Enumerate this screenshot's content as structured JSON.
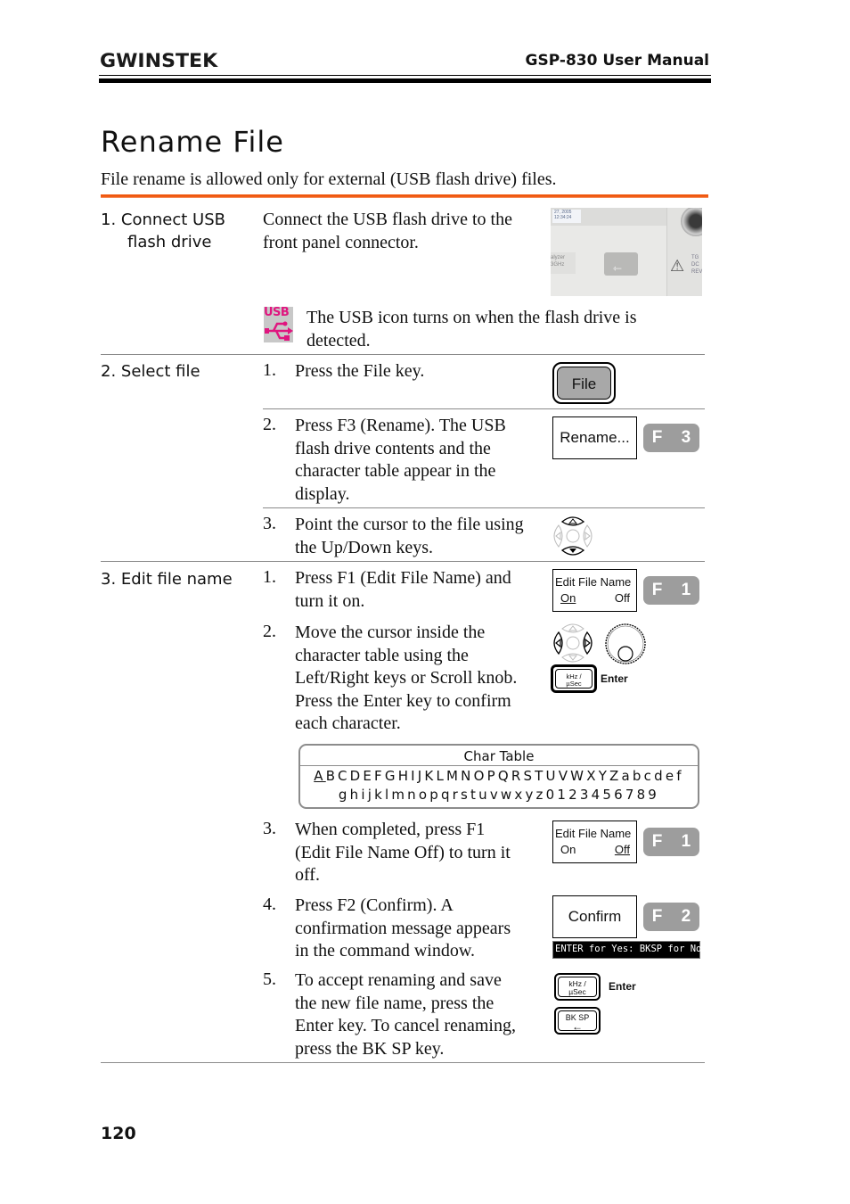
{
  "header": {
    "logo": "GWINSTEK",
    "manual_title": "GSP-830 User Manual"
  },
  "section": {
    "title": "Rename File",
    "intro": "File rename is allowed only for external (USB flash drive) files."
  },
  "steps": [
    {
      "label": "1.  Connect USB flash drive",
      "label_line1": "1.  Connect USB",
      "label_line2": "flash drive",
      "text": "Connect the USB flash drive to the front panel connector.",
      "text_line1": "Connect the USB flash drive to the",
      "text_line2": "front panel connector.",
      "image": {
        "name": "front-panel-usb-port-photo",
        "overlay_text": [
          "27, 2005",
          "12:34:24",
          "alyzer",
          "3GHz",
          "TG",
          "DC",
          "REV"
        ]
      },
      "note_icon": "usb-icon",
      "note_icon_text": "USB",
      "note": "The USB icon turns on when the flash drive is detected.",
      "note_line1": "The USB icon turns on when the flash drive is",
      "note_line2": "detected."
    },
    {
      "label": "2. Select file",
      "substeps": [
        {
          "num": "1.",
          "lines": [
            "Press the File key."
          ],
          "key": "File"
        },
        {
          "num": "2.",
          "lines": [
            "Press F3 (Rename). The USB",
            "flash drive contents and the",
            "character table appear in the",
            "display."
          ],
          "softkey": "Rename...",
          "fkey": "F 3"
        },
        {
          "num": "3.",
          "lines": [
            "Point the cursor to the file using",
            "the Up/Down keys."
          ],
          "icon": "arrow-keys-icon"
        }
      ]
    },
    {
      "label": "3. Edit file name",
      "substeps": [
        {
          "num": "1.",
          "lines": [
            "Press F1 (Edit File Name) and",
            "turn it on."
          ],
          "softkey_title": "Edit File Name",
          "softkey_on": "On",
          "softkey_off": "Off",
          "selected": "On",
          "fkey": "F 1"
        },
        {
          "num": "2.",
          "lines": [
            "Move the cursor inside the",
            "character table using the",
            "Left/Right keys or Scroll knob.",
            "Press the Enter key to confirm",
            "each character."
          ],
          "enter_key_top": "kHz /",
          "enter_key_bottom": "µSec",
          "enter_label": "Enter"
        },
        {
          "num": "3.",
          "lines": [
            "When completed, press F1",
            "(Edit File Name Off) to turn it",
            "off."
          ],
          "softkey_title": "Edit File Name",
          "softkey_on": "On",
          "softkey_off": "Off",
          "selected": "Off",
          "fkey": "F 1"
        },
        {
          "num": "4.",
          "lines": [
            "Press F2 (Confirm). A",
            "confirmation message appears",
            "in the command window."
          ],
          "softkey": "Confirm",
          "fkey": "F 2",
          "message": "ENTER for Yes: BKSP for No:"
        },
        {
          "num": "5.",
          "lines": [
            "To accept renaming and save",
            "the new file name, press the",
            "Enter key. To cancel renaming,",
            "press the BK SP key."
          ],
          "enter_key_top": "kHz /",
          "enter_key_bottom": "µSec",
          "enter_label": "Enter",
          "bksp_top": "BK  SP",
          "bksp_arrow": "←"
        }
      ]
    }
  ],
  "char_table": {
    "title": "Char Table",
    "cursor_char": "A",
    "row1_rest": "BCDEFGHIJKLMNOPQRSTUVWXYZabcdef",
    "row2": "ghijklmnopqrstuvwxyz0123456789"
  },
  "footer": {
    "page_number": "120"
  },
  "colors": {
    "accent_rule": "#f0570e",
    "usb_icon": "#e0157f",
    "fkey_bg": "#9d9d9d"
  }
}
